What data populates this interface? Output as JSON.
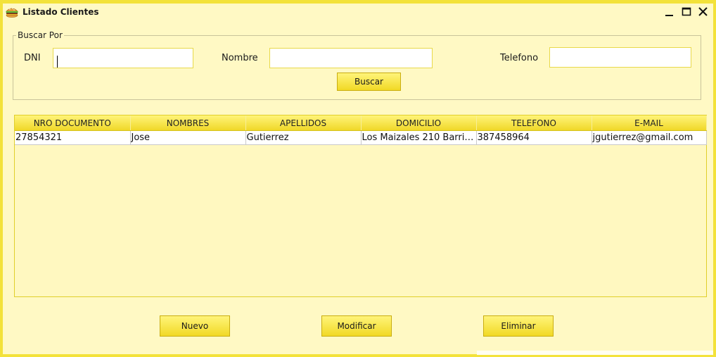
{
  "window": {
    "title": "Listado Clientes"
  },
  "search": {
    "legend": "Buscar Por",
    "dni_label": "DNI",
    "dni_value": "",
    "nombre_label": "Nombre",
    "nombre_value": "",
    "telefono_label": "Telefono",
    "telefono_value": "",
    "buscar_label": "Buscar"
  },
  "table": {
    "columns": [
      "NRO DOCUMENTO",
      "NOMBRES",
      "APELLIDOS",
      "DOMICILIO",
      "TELEFONO",
      "E-MAIL"
    ],
    "rows": [
      [
        "27854321",
        "Jose",
        "Gutierrez",
        "Los Maizales 210 Barrio ...",
        "387458964",
        "jgutierrez@gmail.com"
      ]
    ]
  },
  "actions": {
    "nuevo": "Nuevo",
    "modificar": "Modificar",
    "eliminar": "Eliminar"
  },
  "icons": {
    "app": "burger-icon",
    "minimize": "minimize-icon",
    "maximize": "maximize-icon",
    "close": "close-icon"
  },
  "colors": {
    "window_bg": "#fff9c4",
    "border": "#f3e23a",
    "button_top": "#fff47a",
    "button_bottom": "#f1d925"
  }
}
